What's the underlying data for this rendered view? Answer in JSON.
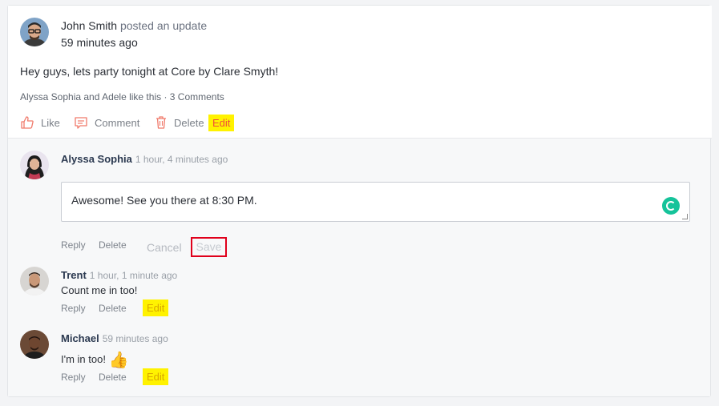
{
  "post": {
    "author": "John Smith",
    "action": "posted an update",
    "time": "59 minutes ago",
    "body": "Hey guys, lets party tonight at Core by Clare Smyth!",
    "likes_text": "Alyssa Sophia and Adele like this · 3 Comments",
    "actions": {
      "like": "Like",
      "comment": "Comment",
      "delete": "Delete",
      "edit": "Edit"
    }
  },
  "comments": [
    {
      "author": "Alyssa Sophia",
      "time": "1 hour, 4 minutes ago",
      "edit_value": "Awesome! See you there at 8:30 PM.",
      "reply": "Reply",
      "delete": "Delete",
      "cancel": "Cancel",
      "save": "Save"
    },
    {
      "author": "Trent",
      "time": "1 hour, 1 minute ago",
      "text": "Count me in too!",
      "reply": "Reply",
      "delete": "Delete",
      "edit": "Edit"
    },
    {
      "author": "Michael",
      "time": "59 minutes ago",
      "text": "I'm in too!",
      "emoji": "👍",
      "reply": "Reply",
      "delete": "Delete",
      "edit": "Edit"
    }
  ],
  "colors": {
    "highlight": "#fff200",
    "save_border": "#e0001b",
    "grammarly": "#15c39a",
    "action_icon": "#f07a6b"
  },
  "icons": [
    "thumbs-up-outline-icon",
    "comment-icon",
    "trash-icon",
    "grammarly-icon",
    "resize-handle-icon"
  ]
}
